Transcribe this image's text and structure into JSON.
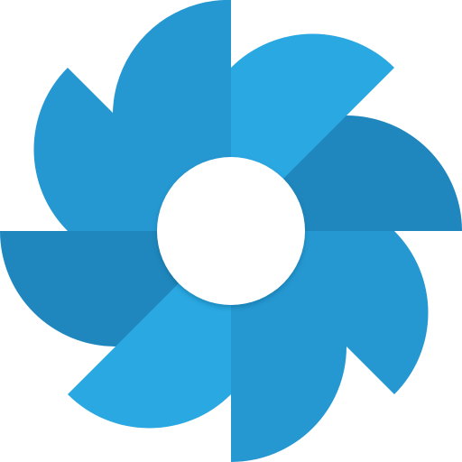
{
  "logo": {
    "icon": "pinwheel-logo-icon",
    "blade_count": 8,
    "colors": {
      "blade_light": "#2AA8E2",
      "blade_mid": "#2598D2",
      "blade_dark": "#1F87BD",
      "hub": "#FFFFFF",
      "hub_shadow": "#0B4F73"
    }
  }
}
